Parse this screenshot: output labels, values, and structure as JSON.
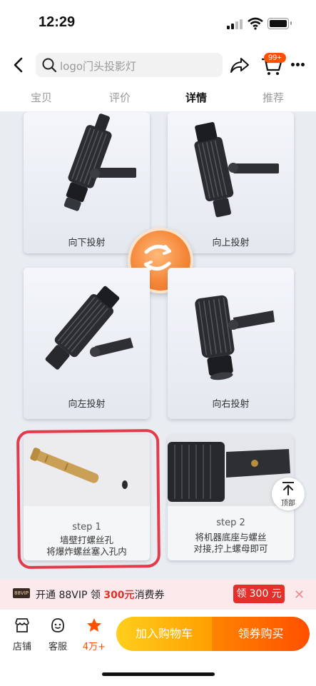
{
  "status_bar": {
    "time": "12:29"
  },
  "header": {
    "search_placeholder": "logo门头投影灯",
    "cart_badge": "99+"
  },
  "tabs": [
    {
      "label": "宝贝",
      "active": false
    },
    {
      "label": "评价",
      "active": false
    },
    {
      "label": "详情",
      "active": true
    },
    {
      "label": "推荐",
      "active": false
    }
  ],
  "detail": {
    "cards": [
      {
        "caption": "向下投射"
      },
      {
        "caption": "向上投射"
      },
      {
        "caption": "向左投射"
      },
      {
        "caption": "向右投射"
      }
    ],
    "steps": [
      {
        "label": "step 1",
        "desc_line1": "墙壁打螺丝孔",
        "desc_line2": "将爆炸螺丝塞入孔内"
      },
      {
        "label": "step 2",
        "desc_line1": "将机器底座与螺丝",
        "desc_line2": "对接,拧上螺母即可"
      }
    ],
    "back_to_top": "顶部"
  },
  "vip_banner": {
    "tag": "88VIP",
    "text_prefix": "开通 88VIP 领 ",
    "amount": "300元",
    "text_suffix": "消费券",
    "button": "领 300 元"
  },
  "bottom_bar": {
    "shop": "店铺",
    "service": "客服",
    "favorite_count": "4万+",
    "add_to_cart": "加入购物车",
    "buy": "领券购买"
  },
  "colors": {
    "accent": "#ff5000",
    "cart_button": "#ffb400",
    "vip_red": "#e4302b",
    "highlight_outline": "#e33a4c"
  },
  "icons": [
    "back-arrow-icon",
    "search-icon",
    "share-icon",
    "cart-icon",
    "more-icon",
    "rotate-icon",
    "store-icon",
    "service-icon",
    "star-icon",
    "arrow-up-icon",
    "close-icon"
  ]
}
